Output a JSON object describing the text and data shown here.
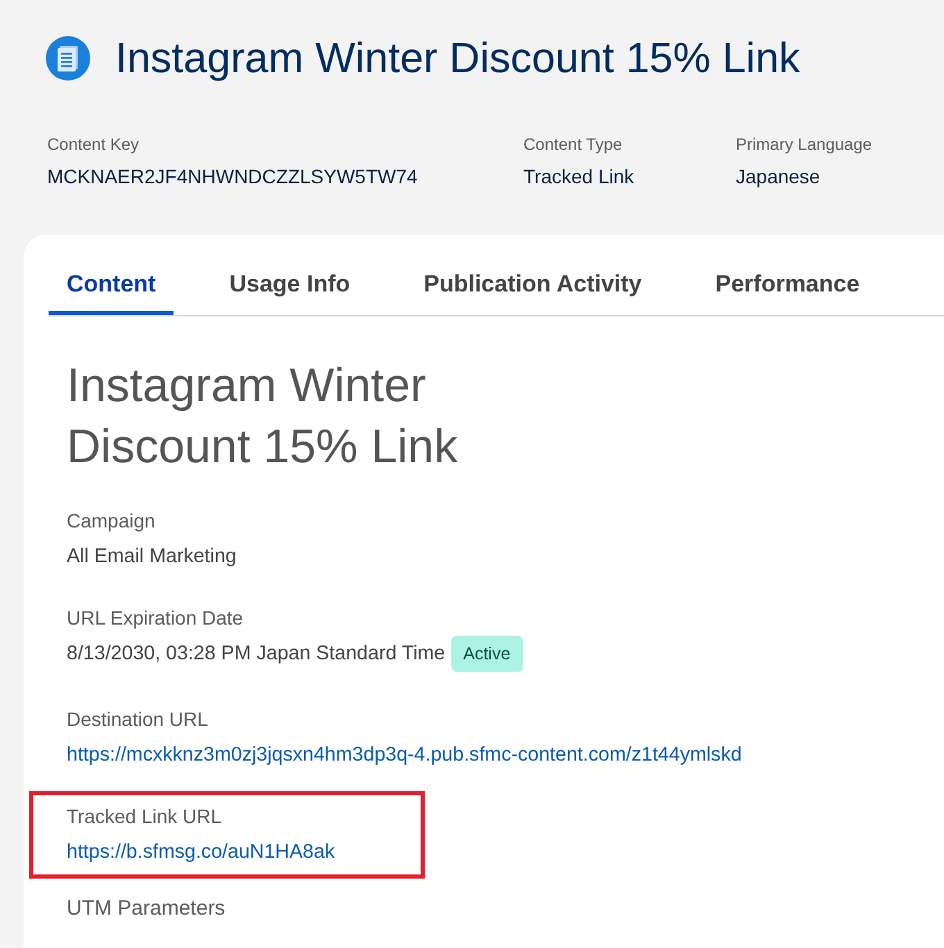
{
  "header": {
    "title": "Instagram Winter Discount 15% Link"
  },
  "summary": [
    {
      "label": "Content Key",
      "value": "MCKNAER2JF4NHWNDCZZLSYW5TW74"
    },
    {
      "label": "Content Type",
      "value": "Tracked Link"
    },
    {
      "label": "Primary Language",
      "value": "Japanese"
    }
  ],
  "tabs": [
    {
      "label": "Content",
      "selected": true
    },
    {
      "label": "Usage Info",
      "selected": false
    },
    {
      "label": "Publication Activity",
      "selected": false
    },
    {
      "label": "Performance",
      "selected": false
    }
  ],
  "content": {
    "heading": "Instagram Winter Discount 15% Link",
    "fields": [
      {
        "kind": "text",
        "label": "Campaign",
        "value": "All Email Marketing",
        "highlighted": false
      },
      {
        "kind": "status",
        "label": "URL Expiration Date",
        "value": "8/13/2030, 03:28 PM Japan Standard Time",
        "badge": "Active",
        "highlighted": false
      },
      {
        "kind": "link",
        "label": "Destination URL",
        "value": "https://mcxkknz3m0zj3jqsxn4hm3dp3q-4.pub.sfmc-content.com/z1t44ymlskd",
        "highlighted": false
      },
      {
        "kind": "link",
        "label": "Tracked Link URL",
        "value": "https://b.sfmsg.co/auN1HA8ak",
        "highlighted": true
      },
      {
        "kind": "section",
        "label": "UTM Parameters",
        "highlighted": false
      }
    ]
  }
}
